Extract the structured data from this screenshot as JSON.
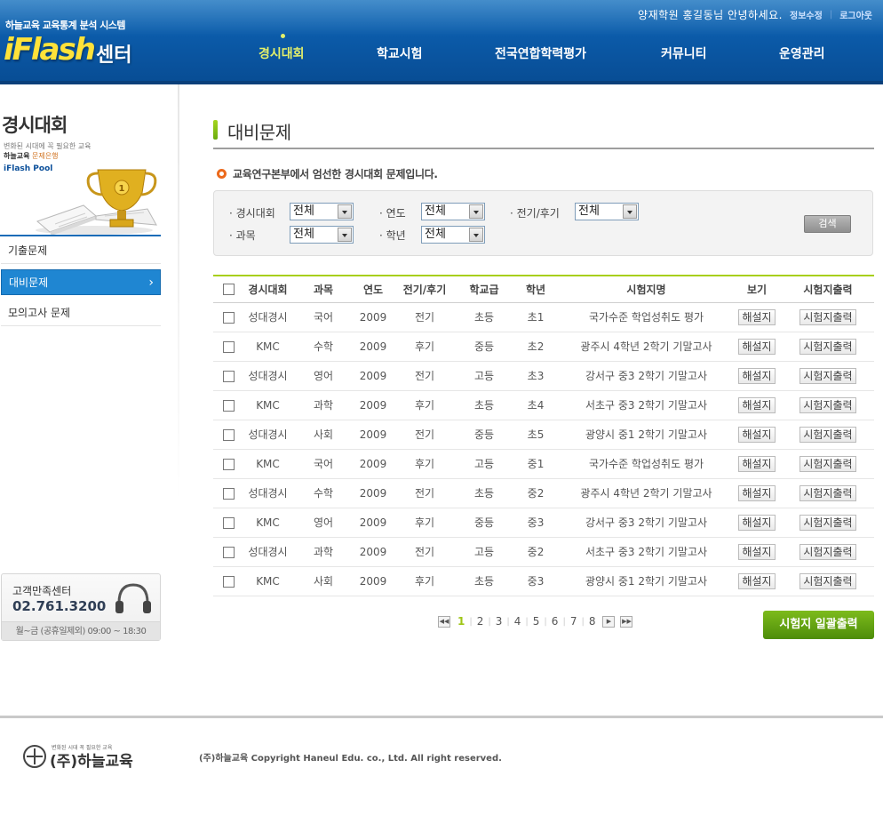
{
  "header": {
    "brand_sub": "하늘교육 교육통계 분석 시스템",
    "brand_logo": "iFlash",
    "brand_center": "센터",
    "greeting": "양재학원 홍길동님 안녕하세요.",
    "profile_link": "정보수정",
    "separator": "|",
    "logout_link": "로그아웃",
    "nav": [
      "경시대회",
      "학교시험",
      "전국연합학력평가",
      "커뮤니티",
      "운영관리"
    ],
    "active_nav": "경시대회"
  },
  "sidebar": {
    "title": "경시대회",
    "desc_line1": "변화된 시대에 꼭 필요한 교육",
    "desc_brand": "하늘교육",
    "desc_rest": "문제은행",
    "pool_label": "iFlash Pool",
    "items": [
      {
        "label": "기출문제"
      },
      {
        "label": "대비문제"
      },
      {
        "label": "모의고사 문제"
      }
    ],
    "active_item": "대비문제",
    "cs": {
      "title": "고객만족센터",
      "phone": "02.761.3200",
      "hours": "월~금 (공휴일제외) 09:00 ~ 18:30"
    }
  },
  "main": {
    "page_title": "대비문제",
    "notice": "교육연구본부에서 엄선한 경시대회 문제입니다.",
    "filters": {
      "contest_label": "· 경시대회",
      "contest_value": "전체",
      "year_label": "· 연도",
      "year_value": "전체",
      "term_label": "· 전기/후기",
      "term_value": "전체",
      "subject_label": "· 과목",
      "subject_value": "전체",
      "grade_label": "· 학년",
      "grade_value": "전체",
      "search_button": "검색"
    },
    "table": {
      "columns": [
        "경시대회",
        "과목",
        "연도",
        "전기/후기",
        "학교급",
        "학년",
        "시험지명",
        "보기",
        "시험지출력"
      ],
      "view_button": "해설지",
      "print_button": "시험지출력",
      "rows": [
        [
          "성대경시",
          "국어",
          "2009",
          "전기",
          "초등",
          "초1",
          "국가수준 학업성취도 평가"
        ],
        [
          "KMC",
          "수학",
          "2009",
          "후기",
          "중등",
          "초2",
          "광주시 4학년 2학기 기말고사"
        ],
        [
          "성대경시",
          "영어",
          "2009",
          "전기",
          "고등",
          "초3",
          "강서구 중3 2학기 기말고사"
        ],
        [
          "KMC",
          "과학",
          "2009",
          "후기",
          "초등",
          "초4",
          "서초구 중3 2학기 기말고사"
        ],
        [
          "성대경시",
          "사회",
          "2009",
          "전기",
          "중등",
          "초5",
          "광양시 중1 2학기 기말고사"
        ],
        [
          "KMC",
          "국어",
          "2009",
          "후기",
          "고등",
          "중1",
          "국가수준 학업성취도 평가"
        ],
        [
          "성대경시",
          "수학",
          "2009",
          "전기",
          "초등",
          "중2",
          "광주시 4학년 2학기 기말고사"
        ],
        [
          "KMC",
          "영어",
          "2009",
          "후기",
          "중등",
          "중3",
          "강서구 중3 2학기 기말고사"
        ],
        [
          "성대경시",
          "과학",
          "2009",
          "전기",
          "고등",
          "중2",
          "서초구 중3 2학기 기말고사"
        ],
        [
          "KMC",
          "사회",
          "2009",
          "후기",
          "초등",
          "중3",
          "광양시 중1 2학기 기말고사"
        ]
      ]
    },
    "pagination": {
      "pages": [
        "1",
        "2",
        "3",
        "4",
        "5",
        "6",
        "7",
        "8"
      ],
      "current": "1",
      "first_icon": "double-chevron-left-icon",
      "next_icon": "chevron-right-icon",
      "last_icon": "double-chevron-right-icon"
    },
    "bulk_print_button": "시험지 일괄출력"
  },
  "footer": {
    "logo_tagline": "변화된 시대 꼭 필요한 교육",
    "logo_text": "(주)하늘교육",
    "copyright": "(주)하늘교육 Copyright Haneul Edu. co., Ltd. All right reserved."
  },
  "colors": {
    "header_blue": "#0b5aa8",
    "accent_green": "#a8cf1a",
    "active_menu_blue": "#1f86d2",
    "notice_orange": "#ec6a1c",
    "nav_active": "#e4f06a"
  }
}
